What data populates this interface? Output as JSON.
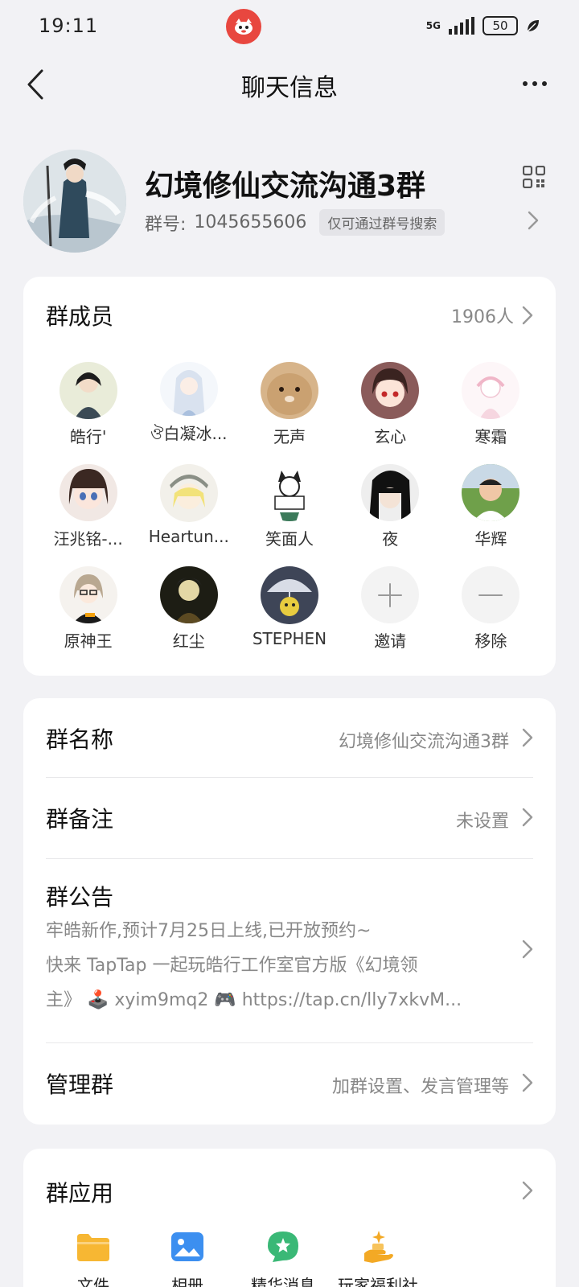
{
  "status_bar": {
    "time": "19:11",
    "network": "5G",
    "battery": "50"
  },
  "nav": {
    "title": "聊天信息"
  },
  "group": {
    "name": "幻境修仙交流沟通3群",
    "id_label": "群号:",
    "id_value": "1045655606",
    "search_tag": "仅可通过群号搜索"
  },
  "members": {
    "title": "群成员",
    "count": "1906人",
    "list": [
      {
        "name": "皓行'",
        "icon": "avatar-anime-swordsman"
      },
      {
        "name": "ঔ白凝冰...",
        "icon": "avatar-white-hair-girl"
      },
      {
        "name": "无声",
        "icon": "avatar-hamster"
      },
      {
        "name": "玄心",
        "icon": "avatar-red-eye-girl"
      },
      {
        "name": "寒霜",
        "icon": "avatar-pink-sketch"
      },
      {
        "name": "汪兆铭-...",
        "icon": "avatar-bob-hair-girl"
      },
      {
        "name": "Heartun...",
        "icon": "avatar-blonde-cap"
      },
      {
        "name": "笑面人",
        "icon": "avatar-cat-ears-sign"
      },
      {
        "name": "夜",
        "icon": "avatar-dark-hair-boy"
      },
      {
        "name": "华辉",
        "icon": "avatar-toddler-photo"
      },
      {
        "name": "原神王",
        "icon": "avatar-glasses-anime"
      },
      {
        "name": "红尘",
        "icon": "avatar-dark-cartoon"
      },
      {
        "name": "STEPHEN",
        "icon": "avatar-umbrella-character"
      }
    ],
    "invite_label": "邀请",
    "remove_label": "移除"
  },
  "settings": {
    "name_label": "群名称",
    "name_value": "幻境修仙交流沟通3群",
    "remark_label": "群备注",
    "remark_value": "未设置",
    "notice_label": "群公告",
    "notice_line1": "牢皓新作,预计7月25日上线,已开放预约~",
    "notice_line2": "快来 TapTap 一起玩皓行工作室官方版《幻境领",
    "notice_line3": "主》 🕹️ xyim9mq2 🎮 https://tap.cn/lly7xkvM...",
    "manage_label": "管理群",
    "manage_value": "加群设置、发言管理等"
  },
  "apps": {
    "title": "群应用",
    "items": [
      {
        "label": "文件",
        "icon": "folder-icon"
      },
      {
        "label": "相册",
        "icon": "photo-album-icon"
      },
      {
        "label": "精华消息",
        "icon": "star-message-icon"
      },
      {
        "label": "玩家福利社",
        "icon": "gift-hand-icon"
      }
    ]
  },
  "colors": {
    "background": "#f2f2f5",
    "card": "#ffffff",
    "primary_text": "#111111",
    "secondary_text": "#888888",
    "app_folder": "#f7b733",
    "app_album": "#3c8ff0",
    "app_essence": "#3ab876",
    "app_welfare": "#f3a925",
    "status_app": "#e8473f"
  }
}
